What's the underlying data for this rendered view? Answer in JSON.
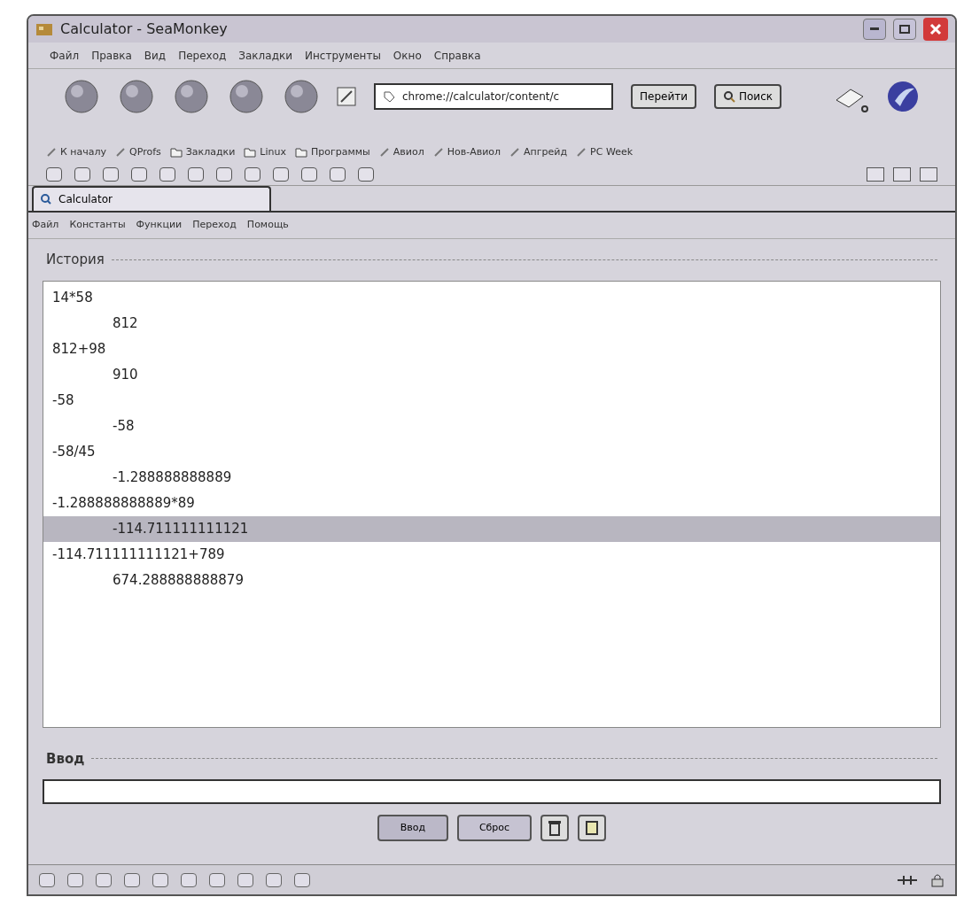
{
  "window": {
    "title": "Calculator - SeaMonkey"
  },
  "menu": [
    "Файл",
    "Правка",
    "Вид",
    "Переход",
    "Закладки",
    "Инструменты",
    "Окно",
    "Справка"
  ],
  "navigation": {
    "url": "chrome://calculator/content/c",
    "go_button": "Перейти",
    "search_button": "Поиск"
  },
  "bookmarks": [
    {
      "label": "К началу"
    },
    {
      "label": "QProfs"
    },
    {
      "label": "Закладки"
    },
    {
      "label": "Linux"
    },
    {
      "label": "Программы"
    },
    {
      "label": "Авиол"
    },
    {
      "label": "Нов-Авиол"
    },
    {
      "label": "Апгрейд"
    },
    {
      "label": "PC Week"
    }
  ],
  "tabs": [
    {
      "label": "Calculator",
      "selected": true
    }
  ],
  "app_menu": [
    "Файл",
    "Константы",
    "Функции",
    "Переход",
    "Помощь"
  ],
  "history": {
    "title": "История",
    "lines": [
      {
        "kind": "expression",
        "text": "14*58",
        "selected": false
      },
      {
        "kind": "result",
        "text": "812",
        "selected": false
      },
      {
        "kind": "expression",
        "text": "812+98",
        "selected": false
      },
      {
        "kind": "result",
        "text": "910",
        "selected": false
      },
      {
        "kind": "expression",
        "text": "-58",
        "selected": false
      },
      {
        "kind": "result",
        "text": "-58",
        "selected": false
      },
      {
        "kind": "expression",
        "text": "-58/45",
        "selected": false
      },
      {
        "kind": "result",
        "text": "-1.288888888889",
        "selected": false
      },
      {
        "kind": "expression",
        "text": "-1.288888888889*89",
        "selected": false
      },
      {
        "kind": "result",
        "text": "-114.711111111121",
        "selected": true
      },
      {
        "kind": "expression",
        "text": "-114.711111111121+789",
        "selected": false
      },
      {
        "kind": "result",
        "text": "674.288888888879",
        "selected": false
      }
    ]
  },
  "input": {
    "title": "Ввод",
    "enter_button": "Ввод",
    "reset_button": "Сброс"
  }
}
